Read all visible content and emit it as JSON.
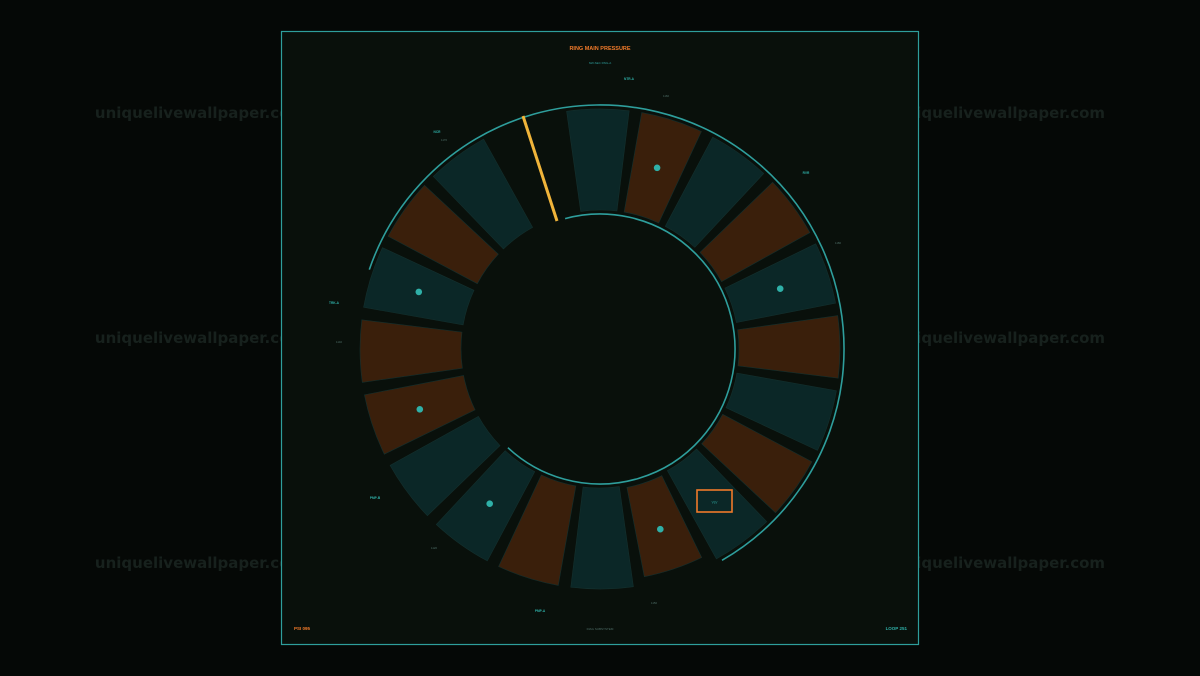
{
  "colors": {
    "background": "#050806",
    "panel": "#09100b",
    "frame": "#2e9e9c",
    "accent_orange": "#f07a2a",
    "accent_teal": "#2fb0a8",
    "segment_teal": "#0b2727",
    "segment_brown": "#3a1f0b",
    "marker_yellow": "#f0b43a"
  },
  "watermark": "uniquelivewallpaper.com",
  "header": {
    "title": "RING MAIN PRESSURE",
    "subtitle": "NW-SEC  RNG-A"
  },
  "ring_labels": [
    {
      "name": "NTR-A",
      "value": "1160"
    },
    {
      "name": "NCR",
      "value": "1170"
    },
    {
      "name": "RVR",
      "value": "1180"
    },
    {
      "name": "TRK-A",
      "value": "1140"
    },
    {
      "name": "PMP-B",
      "value": "1120"
    },
    {
      "name": "PMP-A",
      "value": "1150"
    }
  ],
  "center_box_label": "VLV",
  "footer": {
    "left": "PSI 095",
    "center": "DIAG SUBSYSTEM",
    "right": "LOOP 251"
  },
  "segments": [
    {
      "tone": "teal",
      "dot": false
    },
    {
      "tone": "brown",
      "dot": true
    },
    {
      "tone": "teal",
      "dot": false
    },
    {
      "tone": "brown",
      "dot": false
    },
    {
      "tone": "teal",
      "dot": true
    },
    {
      "tone": "brown",
      "dot": false
    },
    {
      "tone": "teal",
      "dot": false
    },
    {
      "tone": "brown",
      "dot": false
    },
    {
      "tone": "teal",
      "dot": false
    },
    {
      "tone": "brown",
      "dot": true
    },
    {
      "tone": "teal",
      "dot": false
    },
    {
      "tone": "brown",
      "dot": false
    },
    {
      "tone": "teal",
      "dot": true
    },
    {
      "tone": "teal",
      "dot": false
    },
    {
      "tone": "brown",
      "dot": true
    },
    {
      "tone": "brown",
      "dot": false
    },
    {
      "tone": "teal",
      "dot": true
    },
    {
      "tone": "brown",
      "dot": false
    },
    {
      "tone": "teal",
      "dot": false
    }
  ]
}
